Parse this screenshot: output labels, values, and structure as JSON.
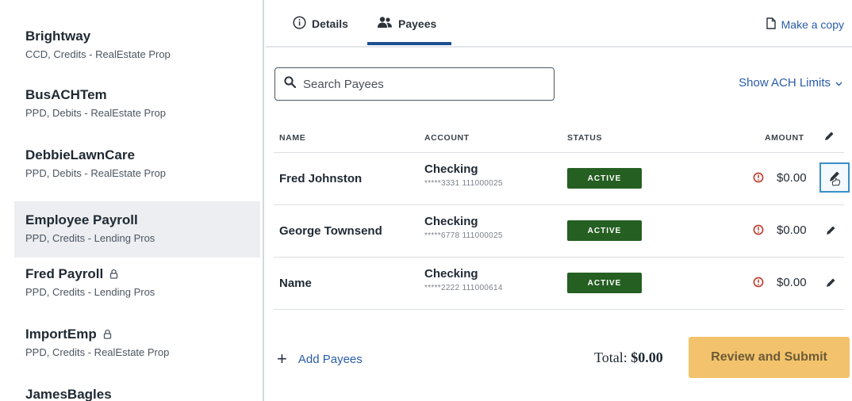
{
  "sidebar": {
    "items": [
      {
        "name": "Brightway",
        "sub": "CCD, Credits - RealEstate Prop",
        "locked": false,
        "selected": false
      },
      {
        "name": "BusACHTem",
        "sub": "PPD, Debits - RealEstate Prop",
        "locked": false,
        "selected": false
      },
      {
        "name": "DebbieLawnCare",
        "sub": "PPD, Debits - RealEstate Prop",
        "locked": false,
        "selected": false
      },
      {
        "name": "Employee Payroll",
        "sub": "PPD, Credits - Lending Pros",
        "locked": false,
        "selected": true
      },
      {
        "name": "Fred Payroll",
        "sub": "PPD, Credits - Lending Pros",
        "locked": true,
        "selected": false
      },
      {
        "name": "ImportEmp",
        "sub": "PPD, Credits - RealEstate Prop",
        "locked": true,
        "selected": false
      },
      {
        "name": "JamesBagles",
        "sub": "",
        "locked": false,
        "selected": false
      }
    ]
  },
  "tabs": {
    "details_label": "Details",
    "payees_label": "Payees",
    "active": "payees"
  },
  "copy_label": "Make a copy",
  "search": {
    "placeholder": "Search Payees",
    "value": ""
  },
  "ach_label": "Show ACH Limits",
  "table": {
    "headers": {
      "name": "NAME",
      "account": "ACCOUNT",
      "status": "STATUS",
      "amount": "AMOUNT"
    },
    "rows": [
      {
        "name": "Fred Johnston",
        "account_type": "Checking",
        "account_number": "*****3331 111000025",
        "status": "ACTIVE",
        "amount": "$0.00",
        "edit_focused": true
      },
      {
        "name": "George Townsend",
        "account_type": "Checking",
        "account_number": "*****6778 111000025",
        "status": "ACTIVE",
        "amount": "$0.00",
        "edit_focused": false
      },
      {
        "name": "Name",
        "account_type": "Checking",
        "account_number": "*****2222 111000614",
        "status": "ACTIVE",
        "amount": "$0.00",
        "edit_focused": false
      }
    ]
  },
  "footer": {
    "add_label": "Add Payees",
    "total_label": "Total:",
    "total_value": "$0.00",
    "submit_label": "Review and Submit"
  },
  "colors": {
    "accent": "#2a5ca8",
    "active_badge": "#255f22",
    "submit": "#f2c36c",
    "warning": "#c0392b",
    "selected_bg": "#eceef1"
  },
  "icons": {
    "details": "info-circle-icon",
    "payees": "users-icon",
    "copy": "document-icon",
    "search": "search-icon",
    "ach": "chevron-down-icon",
    "warning": "alert-circle-icon",
    "edit": "pencil-icon",
    "add": "plus-icon",
    "lock": "lock-icon"
  }
}
